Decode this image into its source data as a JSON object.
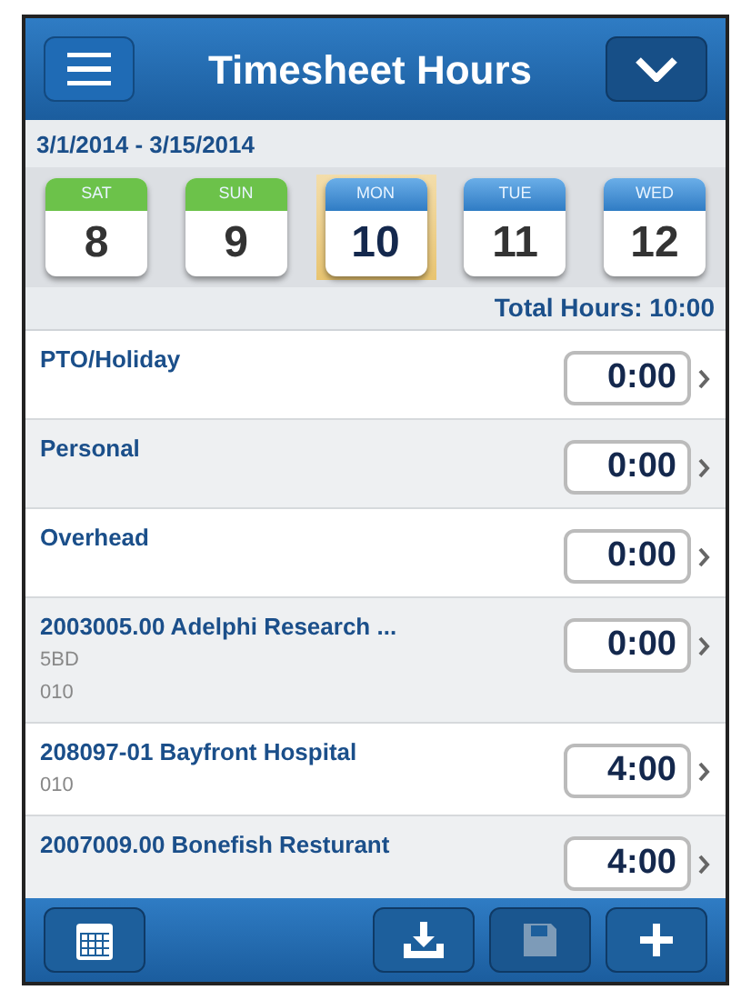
{
  "header": {
    "title": "Timesheet Hours"
  },
  "period": "3/1/2014 - 3/15/2014",
  "days": [
    {
      "weekday": "SAT",
      "date": "8",
      "kind": "weekend",
      "selected": false
    },
    {
      "weekday": "SUN",
      "date": "9",
      "kind": "weekend",
      "selected": false
    },
    {
      "weekday": "MON",
      "date": "10",
      "kind": "weekday",
      "selected": true
    },
    {
      "weekday": "TUE",
      "date": "11",
      "kind": "weekday",
      "selected": false
    },
    {
      "weekday": "WED",
      "date": "12",
      "kind": "weekday",
      "selected": false
    }
  ],
  "total_hours": "Total Hours: 10:00",
  "entries": [
    {
      "name": "PTO/Holiday",
      "hours": "0:00"
    },
    {
      "name": "Personal",
      "hours": "0:00"
    },
    {
      "name": "Overhead",
      "hours": "0:00"
    },
    {
      "name": "2003005.00 Adelphi Research ...",
      "details": [
        "5BD",
        "010"
      ],
      "hours": "0:00"
    },
    {
      "name": "208097-01 Bayfront Hospital",
      "details": [
        "010"
      ],
      "hours": "4:00"
    },
    {
      "name": "2007009.00 Bonefish Resturant",
      "hours": "4:00"
    }
  ],
  "toolbar": [
    {
      "kind": "calendar",
      "disabled": false
    },
    {
      "kind": "download",
      "disabled": false
    },
    {
      "kind": "save",
      "disabled": true
    },
    {
      "kind": "add",
      "disabled": false
    }
  ]
}
